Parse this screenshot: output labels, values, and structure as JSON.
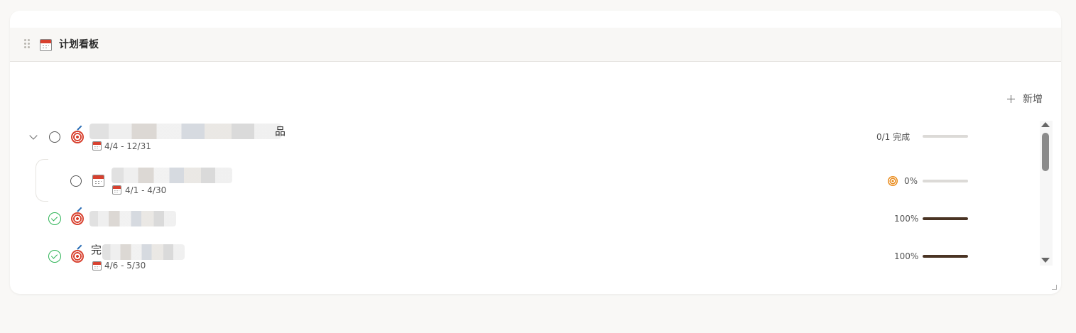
{
  "panel": {
    "title": "计划看板",
    "icon": "calendar-icon"
  },
  "toolbar": {
    "add_label": "新增"
  },
  "items": [
    {
      "title_visible": "",
      "title_tail": "品",
      "date": "4/4 - 12/31",
      "status_text": "0/1 完成",
      "progress": 0,
      "done": false,
      "expanded": true
    },
    {
      "title_visible": "",
      "date": "4/1 - 4/30",
      "status_text": "0%",
      "progress": 0,
      "done": false
    },
    {
      "title_visible": "",
      "date": "",
      "status_text": "100%",
      "progress": 100,
      "done": true
    },
    {
      "title_visible": "完",
      "date": "4/6 - 5/30",
      "status_text": "100%",
      "progress": 100,
      "done": true
    }
  ],
  "colors": {
    "accent_done": "#2fb457",
    "progress_fill": "#4a3424",
    "progress_track": "#dcdad7"
  }
}
